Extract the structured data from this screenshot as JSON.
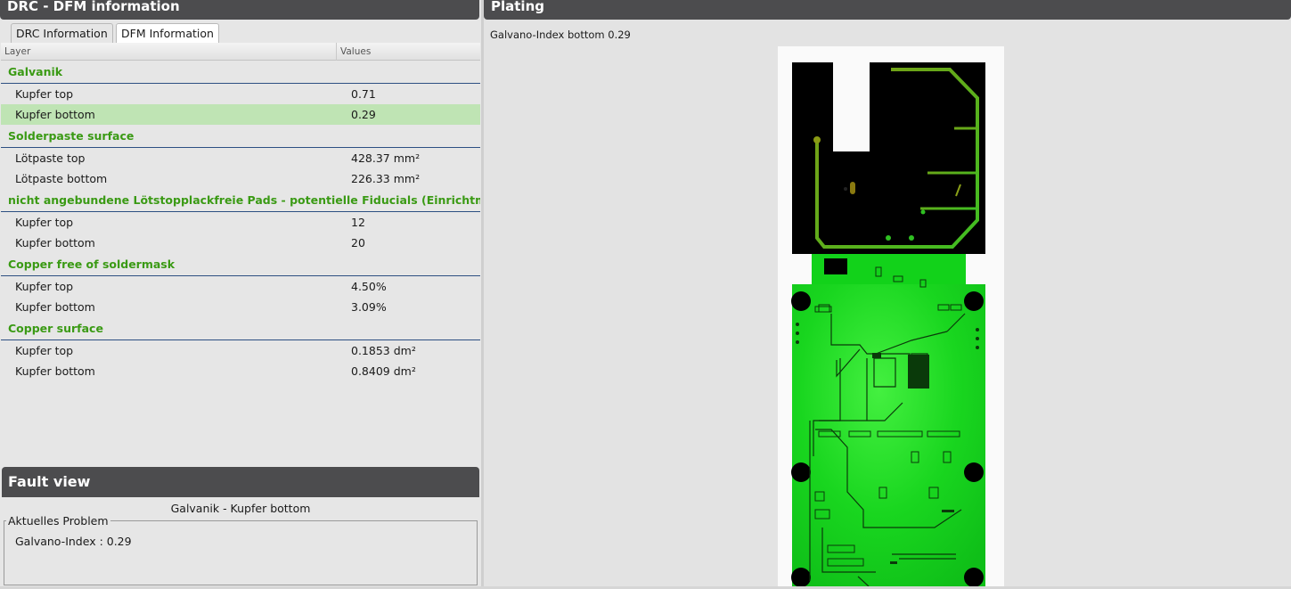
{
  "left_panel": {
    "title": "DRC - DFM information"
  },
  "tabs": [
    {
      "label": "DRC Information",
      "active": false
    },
    {
      "label": "DFM Information",
      "active": true
    }
  ],
  "grid": {
    "columns": [
      "Layer",
      "Values"
    ],
    "groups": [
      {
        "name": "Galvanik",
        "rows": [
          {
            "label": "Kupfer top",
            "value": "0.71"
          },
          {
            "label": "Kupfer bottom",
            "value": "0.29",
            "selected": true
          }
        ]
      },
      {
        "name": "Solderpaste surface",
        "rows": [
          {
            "label": "Lötpaste top",
            "value": "428.37 mm²"
          },
          {
            "label": "Lötpaste bottom",
            "value": "226.33 mm²"
          }
        ]
      },
      {
        "name": "nicht angebundene Lötstopplackfreie Pads - potentielle Fiducials (Einrichtmarken)",
        "rows": [
          {
            "label": "Kupfer top",
            "value": "12"
          },
          {
            "label": "Kupfer bottom",
            "value": "20"
          }
        ]
      },
      {
        "name": "Copper free of soldermask",
        "rows": [
          {
            "label": "Kupfer top",
            "value": "4.50%"
          },
          {
            "label": "Kupfer bottom",
            "value": "3.09%"
          }
        ]
      },
      {
        "name": "Copper surface",
        "rows": [
          {
            "label": "Kupfer top",
            "value": "0.1853 dm²"
          },
          {
            "label": "Kupfer bottom",
            "value": "0.8409 dm²"
          }
        ]
      }
    ]
  },
  "fault_view": {
    "title": "Fault view",
    "item": "Galvanik - Kupfer bottom",
    "group_label": "Aktuelles Problem",
    "problem": "Galvano-Index : 0.29"
  },
  "right_panel": {
    "title": "Plating",
    "subtitle": "Galvano-Index bottom 0.29"
  },
  "colors": {
    "group_text": "#3a9a14",
    "selection": "#bfe4b4",
    "header_bg": "#4c4c4e",
    "board_green": "#19d61f"
  }
}
